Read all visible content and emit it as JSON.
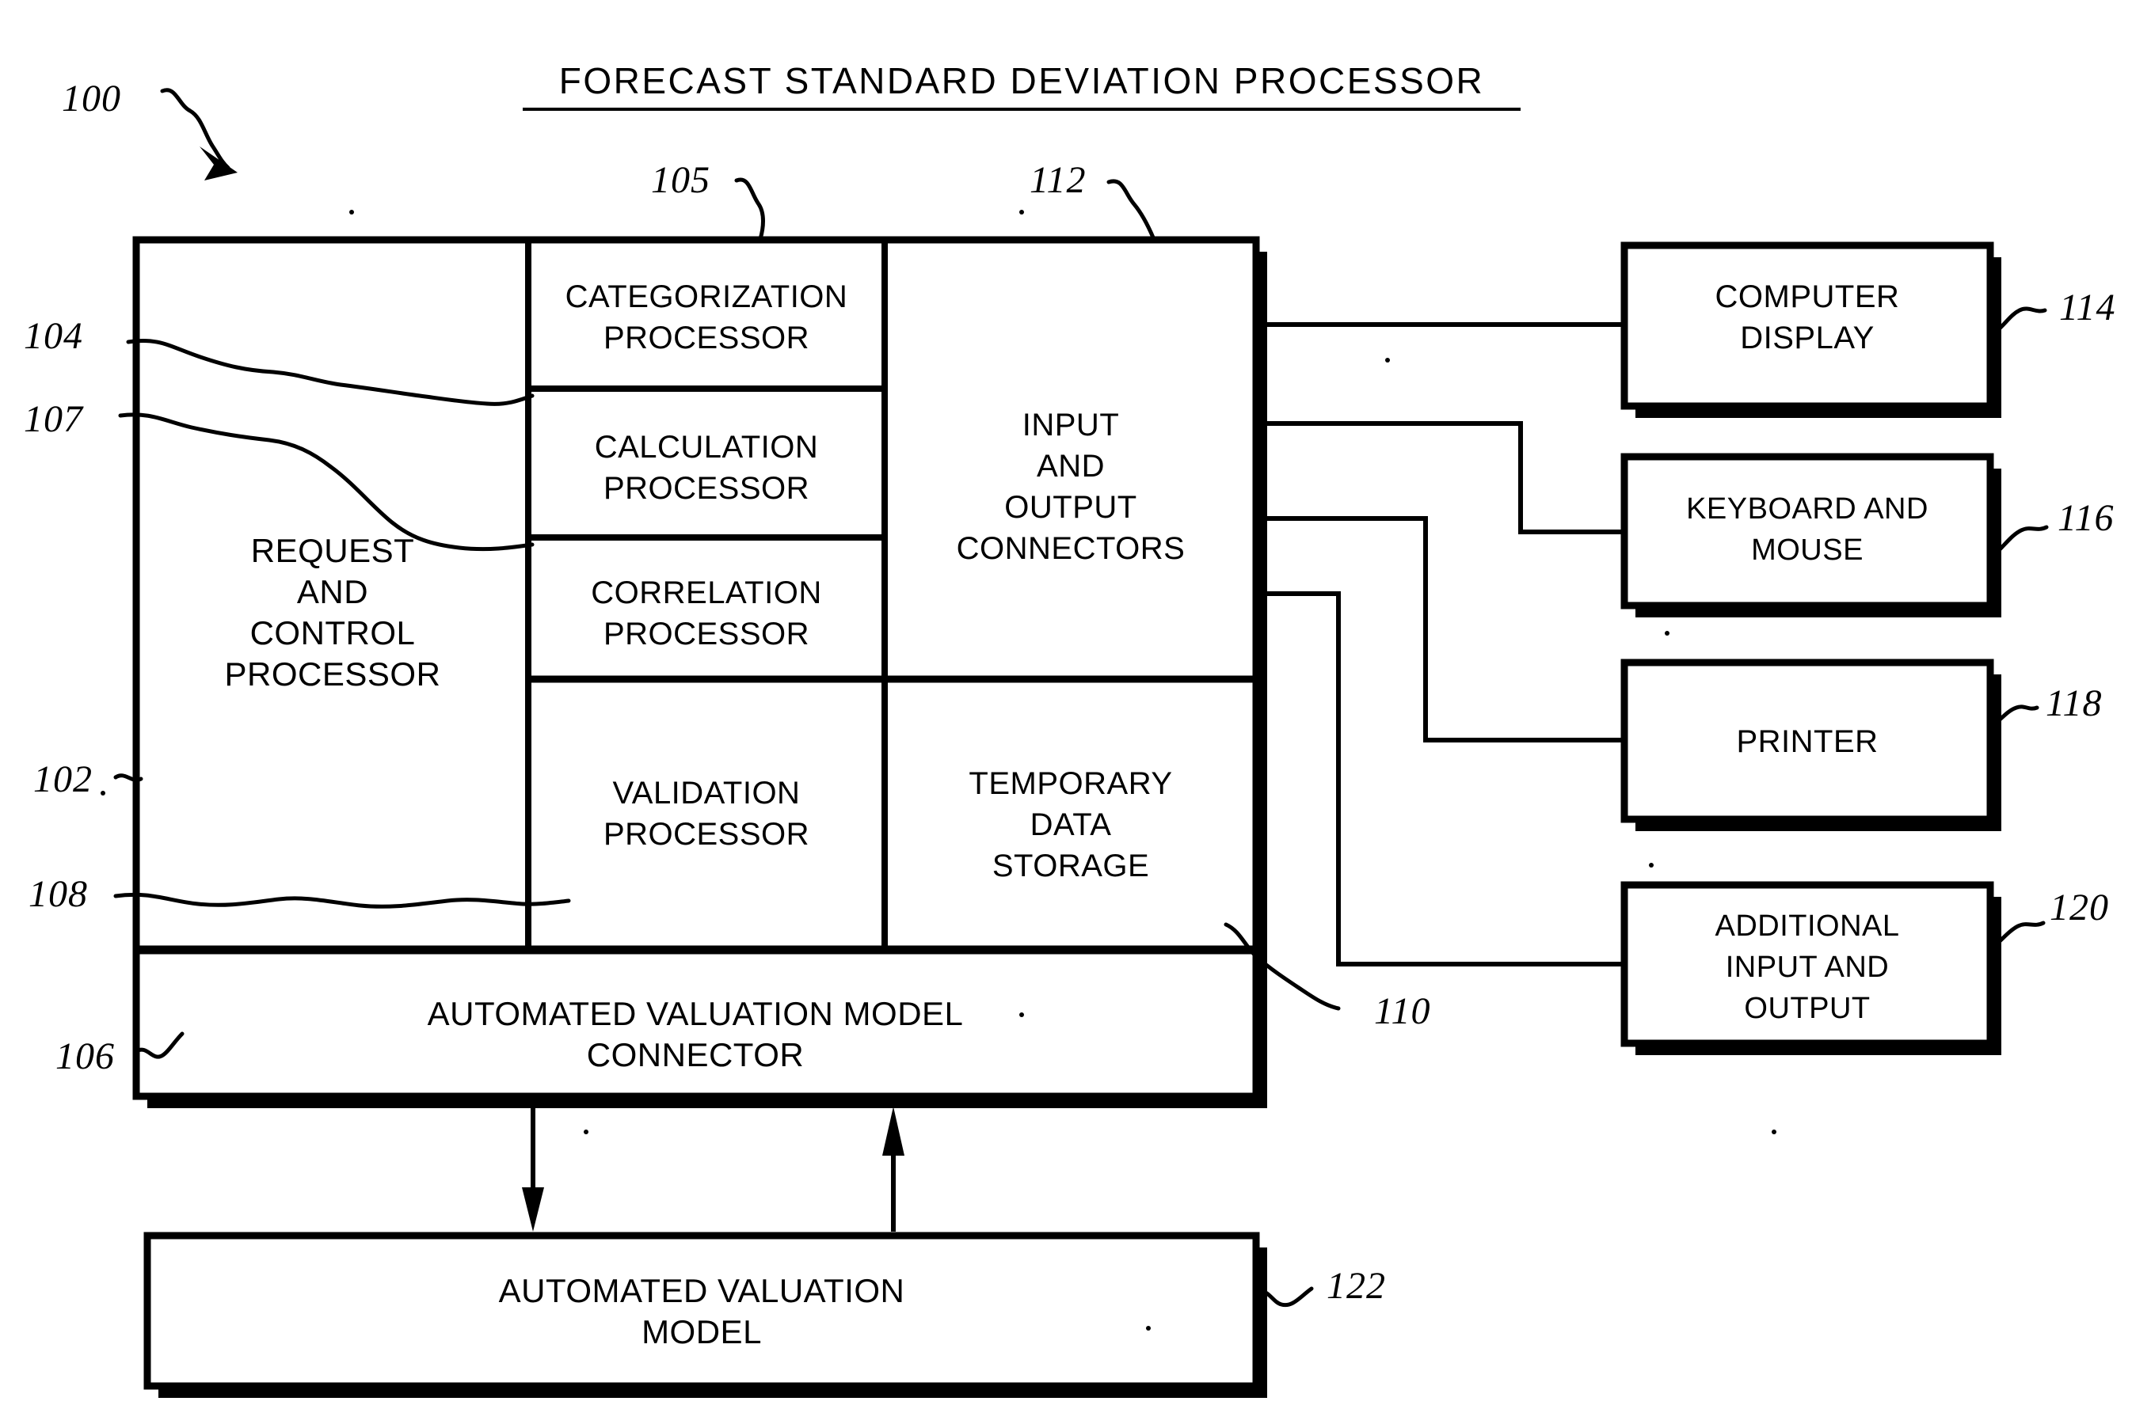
{
  "figure": {
    "title": "FORECAST STANDARD DEVIATION PROCESSOR",
    "ink_color": "#000000",
    "background_color": "#ffffff"
  },
  "system_box": {
    "ref": "102",
    "blocks": {
      "request_control": {
        "ref": "104",
        "line1": "REQUEST",
        "line2": "AND",
        "line3": "CONTROL",
        "line4": "PROCESSOR"
      },
      "categorization": {
        "ref": "105",
        "line1": "CATEGORIZATION",
        "line2": "PROCESSOR"
      },
      "calculation": {
        "ref": "107",
        "line1": "CALCULATION",
        "line2": "PROCESSOR"
      },
      "correlation": {
        "ref": "",
        "line1": "CORRELATION",
        "line2": "PROCESSOR"
      },
      "validation": {
        "ref": "108",
        "line1": "VALIDATION",
        "line2": "PROCESSOR"
      },
      "io_connectors": {
        "ref": "112",
        "line1": "INPUT",
        "line2": "AND",
        "line3": "OUTPUT",
        "line4": "CONNECTORS"
      },
      "temp_storage": {
        "ref": "110",
        "line1": "TEMPORARY",
        "line2": "DATA",
        "line3": "STORAGE"
      },
      "avm_connector": {
        "ref": "106",
        "line1": "AUTOMATED VALUATION MODEL",
        "line2": "CONNECTOR"
      }
    }
  },
  "external_blocks": [
    {
      "ref": "114",
      "line1": "COMPUTER",
      "line2": "DISPLAY"
    },
    {
      "ref": "116",
      "line1": "KEYBOARD AND",
      "line2": "MOUSE"
    },
    {
      "ref": "118",
      "line1": "PRINTER",
      "line2": ""
    },
    {
      "ref": "120",
      "line1": "ADDITIONAL",
      "line2": "INPUT AND",
      "line3": "OUTPUT"
    }
  ],
  "bottom_block": {
    "ref": "122",
    "line1": "AUTOMATED VALUATION",
    "line2": "MODEL"
  },
  "figure_ref": {
    "ref": "100"
  },
  "refs": {
    "r100": "100",
    "r102": "102",
    "r104": "104",
    "r105": "105",
    "r106": "106",
    "r107": "107",
    "r108": "108",
    "r110": "110",
    "r112": "112",
    "r114": "114",
    "r116": "116",
    "r118": "118",
    "r120": "120",
    "r122": "122"
  }
}
